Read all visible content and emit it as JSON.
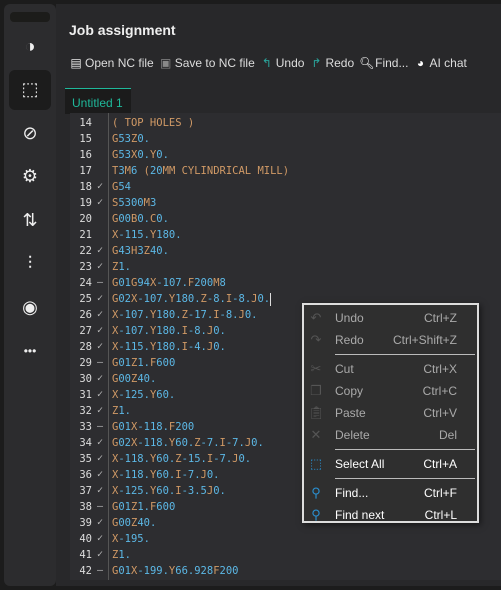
{
  "sidebar": {
    "items": [
      {
        "icon": "quadrant-circle-icon",
        "glyph": "◑"
      },
      {
        "icon": "dashed-shape-icon",
        "glyph": "⬚",
        "active": true
      },
      {
        "icon": "compass-icon",
        "glyph": "⊘"
      },
      {
        "icon": "gear-icon",
        "glyph": "⚙"
      },
      {
        "icon": "transfer-arrows-icon",
        "glyph": "⇅"
      },
      {
        "icon": "drill-bit-icon",
        "glyph": "⫶"
      },
      {
        "icon": "spindle-icon",
        "glyph": "◉"
      },
      {
        "icon": "more-icon",
        "glyph": "•••"
      }
    ]
  },
  "header": {
    "title": "Job assignment"
  },
  "toolbar": {
    "items": [
      {
        "label": "Open NC file",
        "icon": "open-file-icon",
        "glyph": "▤",
        "color": "#e8e8e8"
      },
      {
        "label": "Save to NC file",
        "icon": "save-icon",
        "glyph": "▣",
        "color": "#888888"
      },
      {
        "label": "Undo",
        "icon": "undo-icon",
        "glyph": "↰",
        "color": "#2aa39a"
      },
      {
        "label": "Redo",
        "icon": "redo-icon",
        "glyph": "↱",
        "color": "#2aa39a"
      },
      {
        "label": "Find...",
        "icon": "search-icon",
        "glyph": "🔍︎",
        "color": "#ffffff"
      },
      {
        "label": "AI chat",
        "icon": "ai-chat-icon",
        "glyph": "◕",
        "color": "#ffffff"
      }
    ]
  },
  "tab": {
    "label": "Untitled 1",
    "accent": "#1fb89a"
  },
  "editor": {
    "cursor_line": 25,
    "lines": [
      {
        "n": "14",
        "m": "",
        "t": "( TOP HOLES )"
      },
      {
        "n": "15",
        "m": "",
        "t": "G53Z0."
      },
      {
        "n": "16",
        "m": "",
        "t": "G53X0.Y0."
      },
      {
        "n": "17",
        "m": "",
        "t": "T3M6 (20MM CYLINDRICAL MILL)"
      },
      {
        "n": "18",
        "m": "check",
        "t": "G54"
      },
      {
        "n": "19",
        "m": "check",
        "t": "S5300M3"
      },
      {
        "n": "20",
        "m": "",
        "t": "G00B0.C0."
      },
      {
        "n": "21",
        "m": "",
        "t": "X-115.Y180."
      },
      {
        "n": "22",
        "m": "check",
        "t": "G43H3Z40."
      },
      {
        "n": "23",
        "m": "check",
        "t": "Z1."
      },
      {
        "n": "24",
        "m": "dash",
        "t": "G01G94X-107.F200M8"
      },
      {
        "n": "25",
        "m": "check",
        "t": "G02X-107.Y180.Z-8.I-8.J0."
      },
      {
        "n": "26",
        "m": "check",
        "t": "X-107.Y180.Z-17.I-8.J0."
      },
      {
        "n": "27",
        "m": "check",
        "t": "X-107.Y180.I-8.J0."
      },
      {
        "n": "28",
        "m": "check",
        "t": "X-115.Y180.I-4.J0."
      },
      {
        "n": "29",
        "m": "dash",
        "t": "G01Z1.F600"
      },
      {
        "n": "30",
        "m": "check",
        "t": "G00Z40."
      },
      {
        "n": "31",
        "m": "check",
        "t": "X-125.Y60."
      },
      {
        "n": "32",
        "m": "check",
        "t": "Z1."
      },
      {
        "n": "33",
        "m": "dash",
        "t": "G01X-118.F200"
      },
      {
        "n": "34",
        "m": "check",
        "t": "G02X-118.Y60.Z-7.I-7.J0."
      },
      {
        "n": "35",
        "m": "check",
        "t": "X-118.Y60.Z-15.I-7.J0."
      },
      {
        "n": "36",
        "m": "check",
        "t": "X-118.Y60.I-7.J0."
      },
      {
        "n": "37",
        "m": "check",
        "t": "X-125.Y60.I-3.5J0."
      },
      {
        "n": "38",
        "m": "dash",
        "t": "G01Z1.F600"
      },
      {
        "n": "39",
        "m": "check",
        "t": "G00Z40."
      },
      {
        "n": "40",
        "m": "check",
        "t": "X-195."
      },
      {
        "n": "41",
        "m": "check",
        "t": "Z1."
      },
      {
        "n": "42",
        "m": "dash",
        "t": "G01X-199.Y66.928F200"
      }
    ]
  },
  "context_menu": {
    "items": [
      {
        "label": "Undo",
        "shortcut": "Ctrl+Z",
        "icon": "undo-icon",
        "glyph": "↶",
        "enabled": false
      },
      {
        "label": "Redo",
        "shortcut": "Ctrl+Shift+Z",
        "icon": "redo-icon",
        "glyph": "↷",
        "enabled": false
      },
      {
        "sep": true
      },
      {
        "label": "Cut",
        "shortcut": "Ctrl+X",
        "icon": "scissors-icon",
        "glyph": "✂",
        "enabled": false
      },
      {
        "label": "Copy",
        "shortcut": "Ctrl+C",
        "icon": "copy-icon",
        "glyph": "❐",
        "enabled": false
      },
      {
        "label": "Paste",
        "shortcut": "Ctrl+V",
        "icon": "paste-icon",
        "glyph": "📋︎",
        "enabled": false
      },
      {
        "label": "Delete",
        "shortcut": "Del",
        "icon": "delete-icon",
        "glyph": "✕",
        "enabled": false
      },
      {
        "sep": true
      },
      {
        "label": "Select All",
        "shortcut": "Ctrl+A",
        "icon": "select-all-icon",
        "glyph": "⬚",
        "enabled": true
      },
      {
        "sep": true
      },
      {
        "label": "Find...",
        "shortcut": "Ctrl+F",
        "icon": "search-icon",
        "glyph": "⚲",
        "enabled": true
      },
      {
        "label": "Find next",
        "shortcut": "Ctrl+L",
        "icon": "find-next-icon",
        "glyph": "⚲",
        "enabled": true
      }
    ]
  }
}
